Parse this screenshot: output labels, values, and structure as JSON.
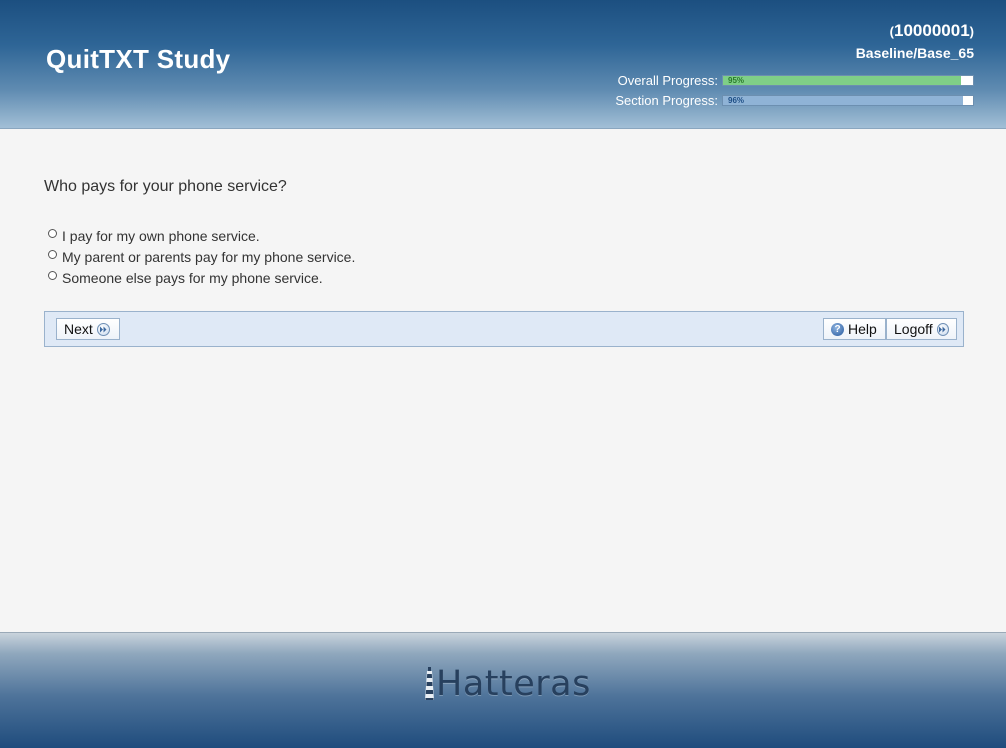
{
  "app": {
    "title": "QuitTXT Study"
  },
  "participant": {
    "paren_open": "(",
    "id": "10000001",
    "paren_close": ")",
    "visit": "Baseline/Base_65"
  },
  "progress": {
    "overall": {
      "label": "Overall Progress:",
      "value_text": "95%",
      "value": 95,
      "color": "#7fcf87"
    },
    "section": {
      "label": "Section Progress:",
      "value_text": "96%",
      "value": 96,
      "color": "#8fb3d6"
    }
  },
  "question": {
    "text": "Who pays for your phone service?",
    "options": [
      {
        "label": "I pay for my own phone service.",
        "selected": false
      },
      {
        "label": "My parent or parents pay for my phone service.",
        "selected": false
      },
      {
        "label": "Someone else pays for my phone service.",
        "selected": false
      }
    ]
  },
  "nav": {
    "next_label": "Next",
    "help_label": "Help",
    "logoff_label": "Logoff",
    "icons": {
      "next": "double-arrow-right-icon",
      "help": "question-mark-icon",
      "logoff": "double-arrow-right-icon"
    }
  },
  "footer": {
    "logo_text": "Hatteras",
    "logo_icon": "lighthouse-icon"
  },
  "colors": {
    "header_top": "#1c4f80",
    "nav_bar_bg": "#dfe9f6",
    "footer_bottom": "#1f4c7d"
  }
}
